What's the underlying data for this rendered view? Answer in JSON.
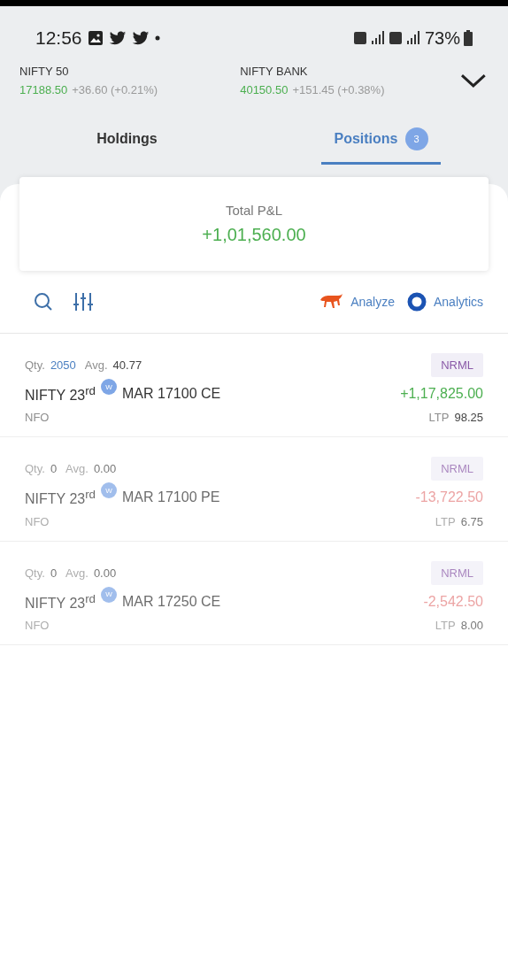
{
  "status_bar": {
    "time": "12:56",
    "battery": "73%"
  },
  "indices": [
    {
      "name": "NIFTY 50",
      "value": "17188.50",
      "change": "+36.60 (+0.21%)"
    },
    {
      "name": "NIFTY BANK",
      "value": "40150.50",
      "change": "+151.45 (+0.38%)"
    }
  ],
  "tabs": [
    {
      "label": "Holdings",
      "selected": false
    },
    {
      "label": "Positions",
      "selected": true,
      "count": "3"
    }
  ],
  "summary": {
    "label": "Total P&L",
    "value": "+1,01,560.00"
  },
  "toolbar": {
    "analyze": "Analyze",
    "analytics": "Analytics"
  },
  "positions": [
    {
      "qty_label": "Qty.",
      "qty": "2050",
      "avg_label": "Avg.",
      "avg": "40.77",
      "product": "NRML",
      "instrument": "NIFTY 23$^{rd}$",
      "weekly": "W",
      "contract": "MAR 17100 CE",
      "pnl": "+1,17,825.00",
      "color": "#4caf50",
      "exchange": "NFO",
      "ltp_label": "LTP",
      "ltp": "98.25",
      "closed": false
    },
    {
      "qty_label": "Qty.",
      "qty": "0",
      "avg_label": "Avg.",
      "avg": "0.00",
      "product": "NRML",
      "instrument": "NIFTY 23$^{rd}$",
      "weekly": "W",
      "contract": "MAR 17100 PE",
      "pnl": "-13,722.50",
      "color": "#eca4a4",
      "exchange": "NFO",
      "ltp_label": "LTP",
      "ltp": "6.75",
      "closed": true
    },
    {
      "qty_label": "Qty.",
      "qty": "0",
      "avg_label": "Avg.",
      "avg": "0.00",
      "product": "NRML",
      "instrument": "NIFTY 23$^{rd}$",
      "weekly": "W",
      "contract": "MAR 17250 CE",
      "pnl": "-2,542.50",
      "color": "#eca4a4",
      "exchange": "NFO",
      "ltp_label": "LTP",
      "ltp": "8.00",
      "closed": true
    }
  ]
}
